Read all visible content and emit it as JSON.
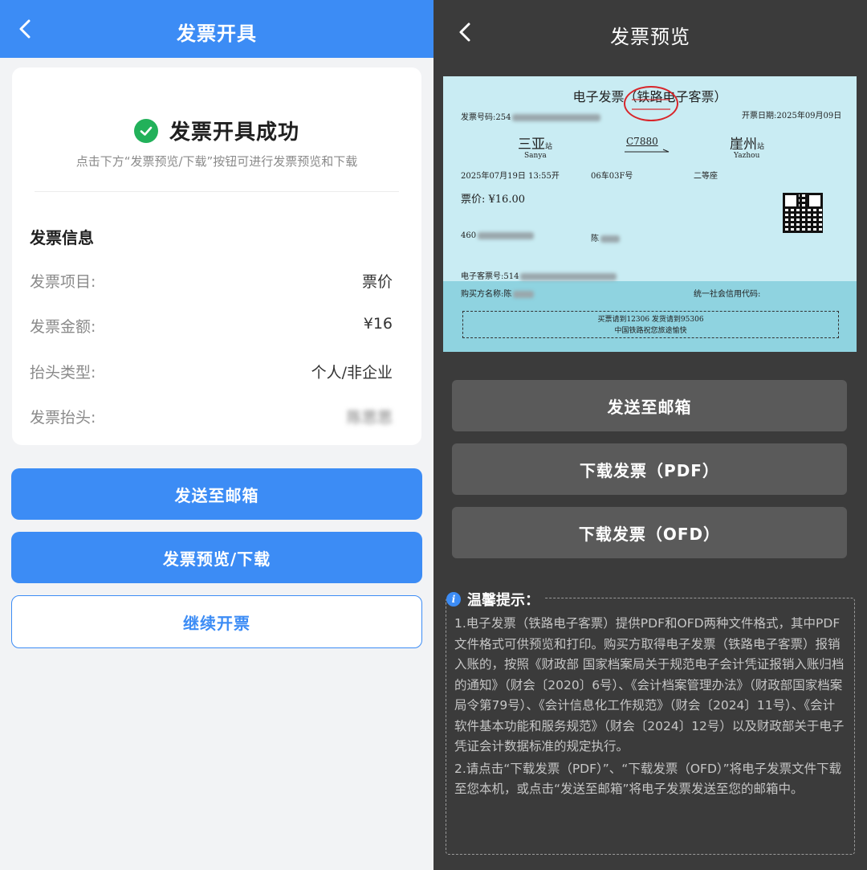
{
  "left": {
    "header_title": "发票开具",
    "success_title": "发票开具成功",
    "success_hint": "点击下方“发票预览/下载”按钮可进行发票预览和下载",
    "section_title": "发票信息",
    "rows": [
      {
        "label": "发票项目:",
        "value": "票价"
      },
      {
        "label": "发票金额:",
        "value": "¥16"
      },
      {
        "label": "抬头类型:",
        "value": "个人/非企业"
      },
      {
        "label": "发票抬头:",
        "value": "陈思思"
      }
    ],
    "buttons": {
      "send_email": "发送至邮箱",
      "preview_download": "发票预览/下载",
      "continue": "继续开票"
    }
  },
  "right": {
    "header_title": "发票预览",
    "ticket": {
      "title": "电子发票（铁路电子客票）",
      "invoice_no_label": "发票号码:254",
      "issue_date": "开票日期:2025年09月09日",
      "from_station": "三亚",
      "from_pinyin": "Sanya",
      "to_station": "崖州",
      "to_pinyin": "Yazhou",
      "station_suffix": "站",
      "train_no": "C7880",
      "depart": "2025年07月19日    13:55开",
      "seat": "06车03F号",
      "seat_class": "二等座",
      "price": "票价: ¥16.00",
      "id_prefix": "460",
      "name_prefix": "陈",
      "eticket_no": "电子客票号:514",
      "buyer": "购买方名称:陈",
      "credit_code": "统一社会信用代码:",
      "notice_line1": "买票请到12306 发货请到95306",
      "notice_line2": "中国铁路祝您旅途愉快"
    },
    "buttons": {
      "send_email": "发送至邮箱",
      "download_pdf": "下载发票（PDF）",
      "download_ofd": "下载发票（OFD）"
    },
    "tips": {
      "title": "温馨提示：",
      "p1": "1.电子发票（铁路电子客票）提供PDF和OFD两种文件格式，其中PDF文件格式可供预览和打印。购买方取得电子发票（铁路电子客票）报销入账的，按照《财政部 国家档案局关于规范电子会计凭证报销入账归档的通知》（财会〔2020〕6号）、《会计档案管理办法》（财政部国家档案局令第79号）、《会计信息化工作规范》（财会〔2024〕11号）、《会计软件基本功能和服务规范》（财会〔2024〕12号）以及财政部关于电子凭证会计数据标准的规定执行。",
      "p2": "2.请点击“下载发票（PDF）”、“下载发票（OFD）”将电子发票文件下载至您本机，或点击“发送至邮箱”将电子发票发送至您的邮箱中。"
    }
  }
}
